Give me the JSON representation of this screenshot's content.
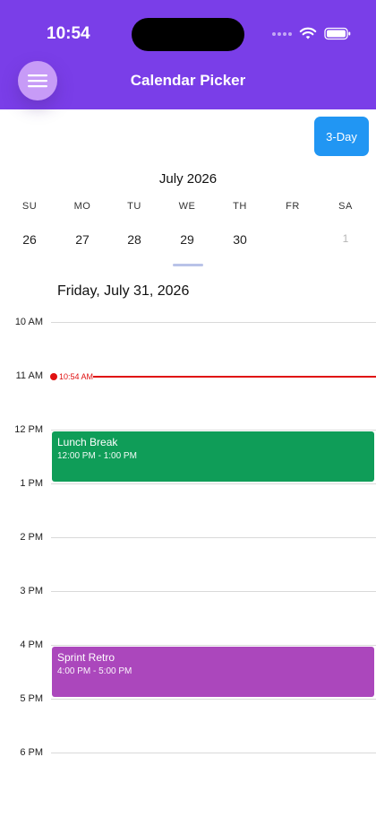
{
  "status_bar": {
    "time": "10:54"
  },
  "header": {
    "title": "Calendar Picker"
  },
  "view_button": {
    "label": "3-Day"
  },
  "calendar": {
    "month": "July 2026",
    "weekdays": [
      "SU",
      "MO",
      "TU",
      "WE",
      "TH",
      "FR",
      "SA"
    ],
    "days": [
      "26",
      "27",
      "28",
      "29",
      "30",
      "",
      "1"
    ]
  },
  "day_view": {
    "selected_date": "Friday, July 31, 2026",
    "hours": [
      "10 AM",
      "11 AM",
      "12 PM",
      "1 PM",
      "2 PM",
      "3 PM",
      "4 PM",
      "5 PM",
      "6 PM"
    ],
    "now_label": "10:54 AM",
    "events": [
      {
        "title": "Lunch Break",
        "time": "12:00 PM - 1:00 PM",
        "color": "#0f9d58"
      },
      {
        "title": "Sprint Retro",
        "time": "4:00 PM - 5:00 PM",
        "color": "#ab47bc"
      }
    ]
  },
  "colors": {
    "header": "#7a3ee8",
    "button": "#2196f3",
    "now_indicator": "#e01010"
  }
}
